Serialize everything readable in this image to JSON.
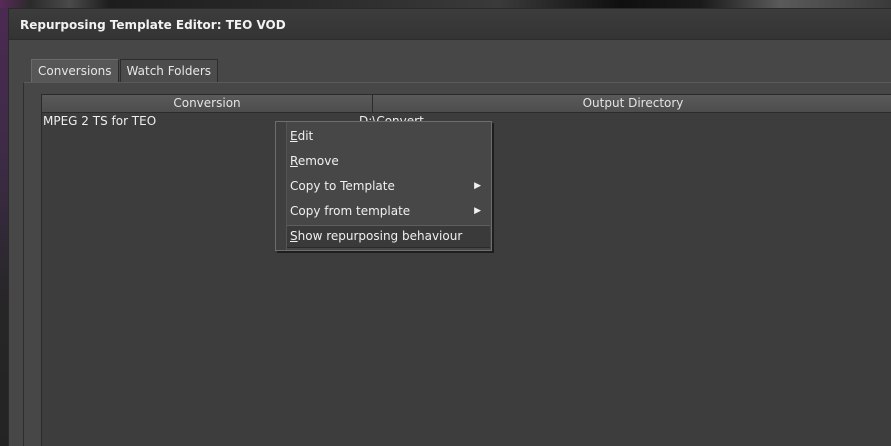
{
  "window": {
    "title": "Repurposing Template Editor: TEO VOD"
  },
  "tabs": [
    {
      "label": "Conversions",
      "active": true
    },
    {
      "label": "Watch Folders",
      "active": false
    }
  ],
  "table": {
    "columns": [
      "Conversion",
      "Output Directory"
    ],
    "rows": [
      {
        "conversion": "MPEG 2 TS for TEO",
        "output_directory": "D:\\Convert"
      }
    ]
  },
  "context_menu": {
    "items": [
      {
        "first_letter": "E",
        "rest": "dit",
        "submenu": false
      },
      {
        "first_letter": "R",
        "rest": "emove",
        "submenu": false
      },
      {
        "first_letter": "",
        "rest": "Copy to Template",
        "submenu": true
      },
      {
        "first_letter": "",
        "rest": "Copy from template",
        "submenu": true
      },
      {
        "first_letter": "S",
        "rest": "how repurposing behaviour",
        "submenu": false
      }
    ],
    "submenu_arrow": "▶"
  },
  "colors": {
    "background": "#474747",
    "table_background": "#3d3d3d",
    "text": "#e8e8e8"
  }
}
